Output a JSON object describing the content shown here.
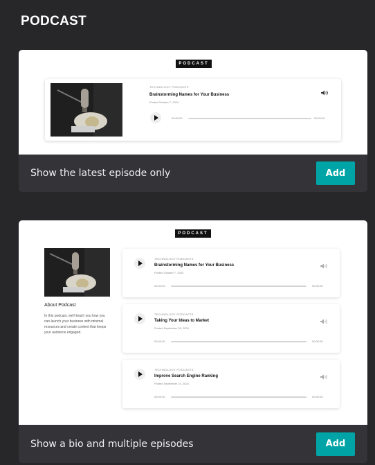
{
  "panel": {
    "title": "PODCAST"
  },
  "cards": [
    {
      "tag": "PODCAST",
      "label": "Show the latest episode only",
      "add_label": "Add",
      "episode": {
        "category": "TECHNOLOGY PODCASTS",
        "title": "Brainstorming Names for Your Business",
        "date": "Posted October 7, 2024",
        "current_time": "00:00:00",
        "duration": "00:00:00"
      }
    },
    {
      "tag": "PODCAST",
      "label": "Show a bio and multiple episodes",
      "add_label": "Add",
      "bio": {
        "title": "About Podcast",
        "text": "In this podcast, we'll teach you how you can launch your business with minimal resources and create content that keeps your audience engaged."
      },
      "episodes": [
        {
          "category": "TECHNOLOGY PODCASTS",
          "title": "Brainstorming Names for Your Business",
          "date": "Posted October 7, 2024",
          "current_time": "00:00:00",
          "duration": "00:00:00"
        },
        {
          "category": "TECHNOLOGY PODCASTS",
          "title": "Taking Your Ideas to Market",
          "date": "Posted September 30, 2024",
          "current_time": "00:00:00",
          "duration": "00:00:00"
        },
        {
          "category": "TECHNOLOGY PODCASTS",
          "title": "Improve Search Engine Ranking",
          "date": "Posted September 23, 2024",
          "current_time": "00:00:00",
          "duration": "00:00:00"
        }
      ]
    }
  ],
  "colors": {
    "background": "#27272a",
    "card_footer": "#333338",
    "accent": "#00a4a6"
  }
}
